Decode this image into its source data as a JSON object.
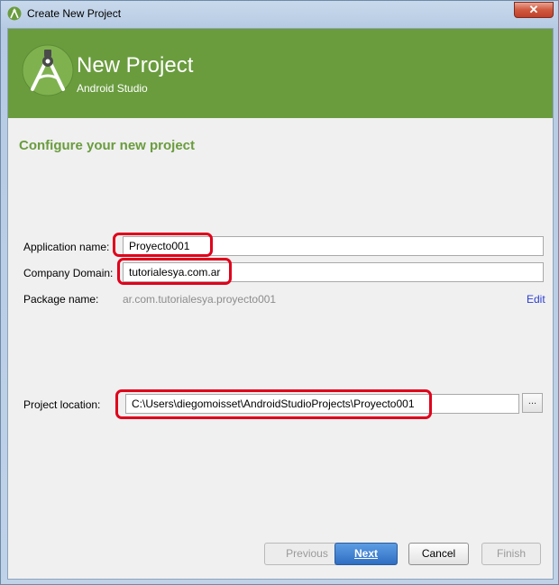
{
  "window": {
    "title": "Create New Project",
    "close_symbol": "✕"
  },
  "header": {
    "title": "New Project",
    "subtitle": "Android Studio"
  },
  "section_title": "Configure your new project",
  "form": {
    "app_name_label": "Application name:",
    "app_name_value": "Proyecto001",
    "company_domain_label": "Company Domain:",
    "company_domain_value": "tutorialesya.com.ar",
    "package_name_label": "Package name:",
    "package_name_value": "ar.com.tutorialesya.proyecto001",
    "edit_label": "Edit",
    "location_label": "Project location:",
    "location_value": "C:\\Users\\diegomoisset\\AndroidStudioProjects\\Proyecto001",
    "browse_label": "..."
  },
  "buttons": {
    "previous": "Previous",
    "next": "Next",
    "cancel": "Cancel",
    "finish": "Finish"
  },
  "colors": {
    "header_bg": "#6a9c3e",
    "accent_green": "#6a9c3e",
    "highlight_red": "#e0001b",
    "link_blue": "#2b3fd1"
  },
  "icons": [
    "android-studio-icon",
    "android-studio-logo",
    "close-icon",
    "browse-icon"
  ]
}
